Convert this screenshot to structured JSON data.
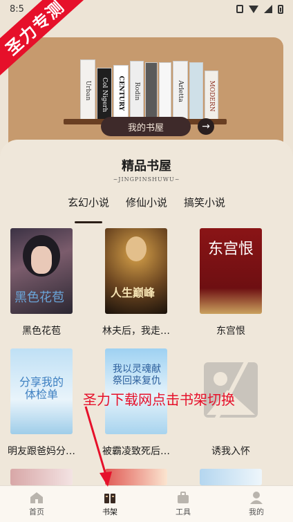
{
  "status_bar": {
    "time": "8:5"
  },
  "watermark": {
    "corner": "圣力专测",
    "caption": "圣力下载网点击书架切换"
  },
  "hero": {
    "button_label": "我的书屋",
    "spine_titles": [
      "Urban",
      "Col Nigerh",
      "CENTURY",
      "Rodin",
      "",
      "",
      "Arletta",
      "",
      "MODERN"
    ]
  },
  "section": {
    "title": "精品书屋",
    "subtitle": "~JINGPINSHUWU~"
  },
  "tabs": [
    {
      "label": "玄幻小说",
      "active": true
    },
    {
      "label": "修仙小说",
      "active": false
    },
    {
      "label": "搞笑小说",
      "active": false
    }
  ],
  "books": [
    {
      "name": "黑色花苞",
      "cover_text": "黑色花苞"
    },
    {
      "name": "林夫后，我走…",
      "cover_text": "人生巅峰"
    },
    {
      "name": "东宫恨",
      "cover_text": "东宫恨"
    },
    {
      "name": "明友跟爸妈分…",
      "cover_text": "分享我的体检单"
    },
    {
      "name": "被霸凌致死后…",
      "cover_text": "我以灵魂献祭回来复仇"
    },
    {
      "name": "诱我入怀",
      "cover_text": ""
    }
  ],
  "tabbar": [
    {
      "label": "首页",
      "icon": "home-icon"
    },
    {
      "label": "书架",
      "icon": "bookshelf-icon"
    },
    {
      "label": "工具",
      "icon": "toolbox-icon"
    },
    {
      "label": "我的",
      "icon": "profile-icon"
    }
  ]
}
